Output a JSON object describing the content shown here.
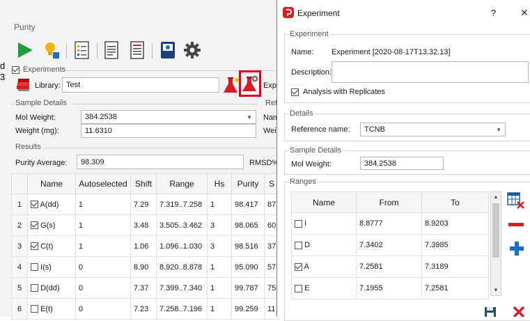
{
  "purity_window": {
    "title": "Purity",
    "cut_left_chars": [
      "d",
      "3"
    ],
    "experiments_label": "Experiments",
    "experiments_checked": true,
    "library_label": "Library:",
    "library_value": "Test",
    "exp_partial_label": "Expe",
    "sample_details_legend": "Sample Details",
    "ref_partial_legend": "Ref",
    "mol_weight_label": "Mol Weight:",
    "mol_weight_value": "384.2538",
    "weight_label": "Weight (mg):",
    "weight_value": "11.6310",
    "nam_partial": "Nam",
    "wei_partial": "Wei",
    "results_legend": "Results",
    "purity_avg_label": "Purity Average:",
    "purity_avg_value": "98.309",
    "rmsd_label": "RMSD%:",
    "table_headers": [
      "Name",
      "Autoselected",
      "Shift",
      "Range",
      "Hs",
      "Purity",
      "S"
    ],
    "table_rows": [
      {
        "n": "1",
        "checked": true,
        "name": "A(dd)",
        "auto": "1",
        "shift": "7.29",
        "range": "7.319..7.258",
        "hs": "1",
        "purity": "98.417",
        "s": "87"
      },
      {
        "n": "2",
        "checked": true,
        "name": "G(s)",
        "auto": "1",
        "shift": "3.48",
        "range": "3.505..3.462",
        "hs": "3",
        "purity": "98.065",
        "s": "60"
      },
      {
        "n": "3",
        "checked": true,
        "name": "C(t)",
        "auto": "1",
        "shift": "1.06",
        "range": "1.096..1.030",
        "hs": "3",
        "purity": "98.516",
        "s": "37"
      },
      {
        "n": "4",
        "checked": false,
        "name": "I(s)",
        "auto": "0",
        "shift": "8.90",
        "range": "8.920..8.878",
        "hs": "1",
        "purity": "95.090",
        "s": "57"
      },
      {
        "n": "5",
        "checked": false,
        "name": "D(dd)",
        "auto": "0",
        "shift": "7.37",
        "range": "7.399..7.340",
        "hs": "1",
        "purity": "99.787",
        "s": "75"
      },
      {
        "n": "6",
        "checked": false,
        "name": "E(t)",
        "auto": "0",
        "shift": "7.23",
        "range": "7.258..7.196",
        "hs": "1",
        "purity": "99.259",
        "s": "11"
      }
    ]
  },
  "dialog": {
    "title": "Experiment",
    "help": "?",
    "close": "✕",
    "experiment_legend": "Experiment",
    "name_label": "Name:",
    "name_value": "Experiment [2020-08-17T13.32.13]",
    "description_label": "Description:",
    "description_value": "",
    "replicates_label": "Analysis with Replicates",
    "replicates_checked": true,
    "details_legend": "Details",
    "reference_label": "Reference name:",
    "reference_value": "TCNB",
    "sample_details_legend": "Sample Details",
    "mol_weight_label": "Mol Weight:",
    "mol_weight_value": "384.2538",
    "ranges_legend": "Ranges",
    "ranges_headers": [
      "Name",
      "From",
      "To"
    ],
    "ranges_rows": [
      {
        "checked": false,
        "name": "I",
        "from": "8.8777",
        "to": "8.9203"
      },
      {
        "checked": false,
        "name": "D",
        "from": "7.3402",
        "to": "7.3985"
      },
      {
        "checked": true,
        "name": "A",
        "from": "7.2581",
        "to": "7.3189"
      },
      {
        "checked": false,
        "name": "E",
        "from": "7.1955",
        "to": "7.2581"
      }
    ]
  },
  "colors": {
    "accent_red": "#d81b24",
    "add_blue": "#1a6fc4",
    "play_green": "#1e9e3a",
    "highlight_box": "#e3001b"
  },
  "icons": [
    "play-icon",
    "lightbulb-icon",
    "checklist-icon",
    "document-icon",
    "report-icon",
    "book-icon",
    "gear-icon",
    "library-books-icon",
    "flask-new-icon",
    "flask-settings-icon",
    "app-logo-icon",
    "table-delete-icon",
    "remove-icon",
    "add-icon",
    "save-icon",
    "close-red-icon"
  ]
}
